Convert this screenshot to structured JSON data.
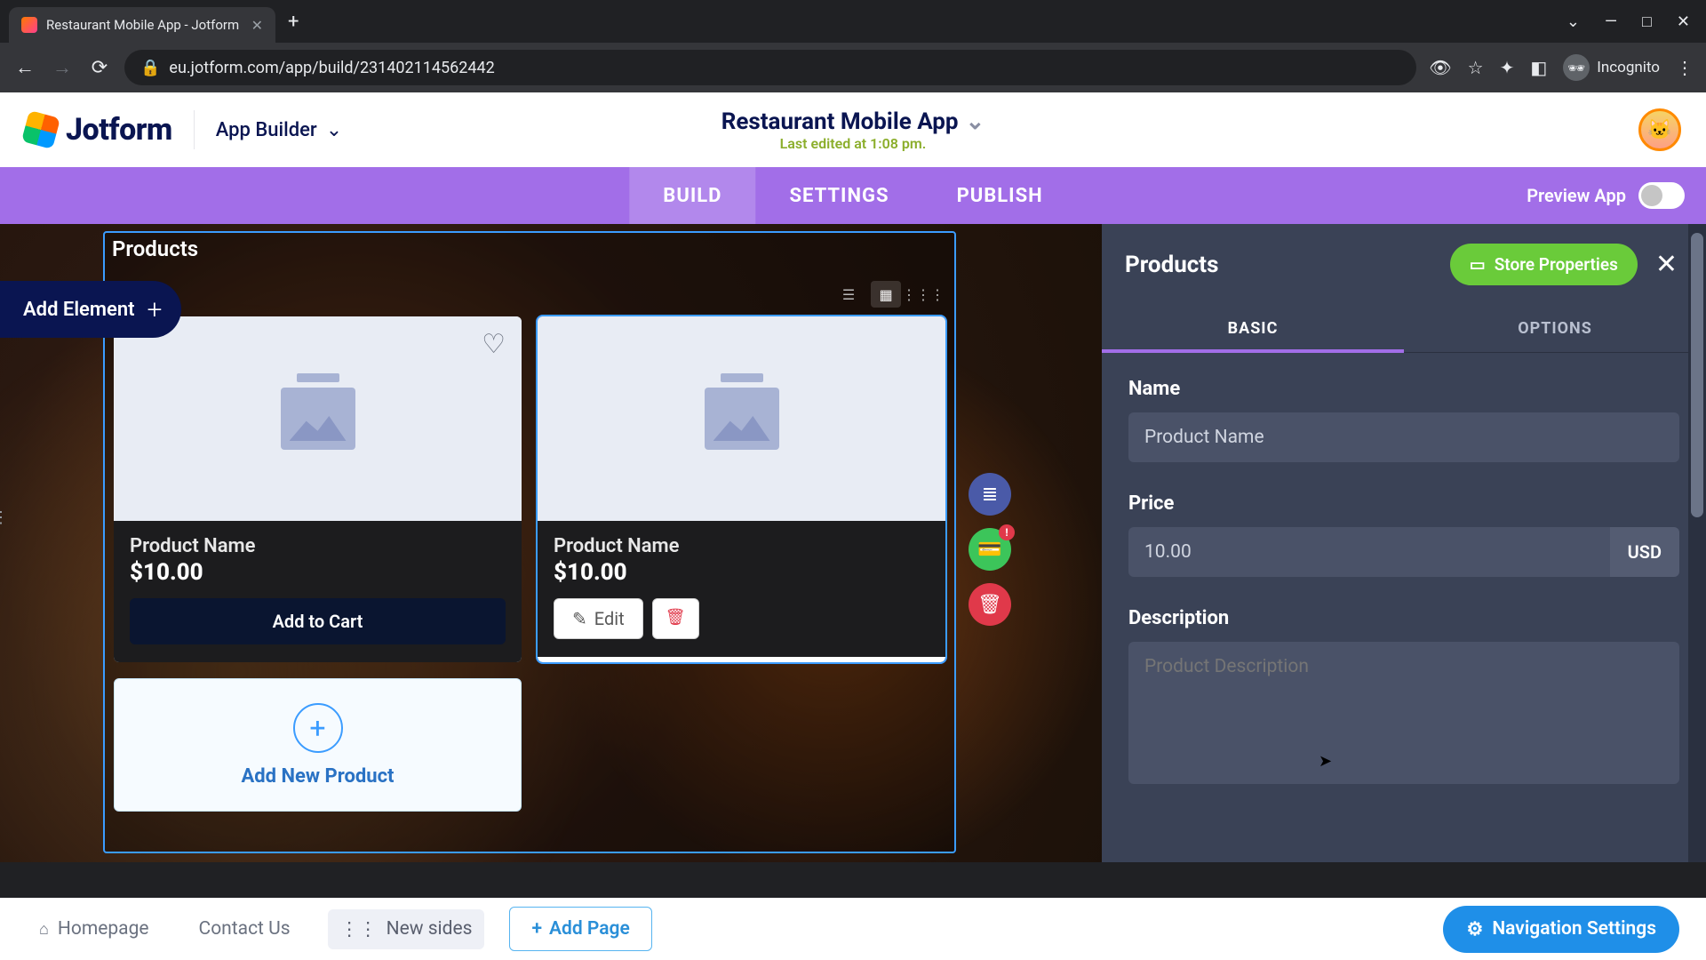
{
  "browser": {
    "tab_title": "Restaurant Mobile App - Jotform",
    "url": "eu.jotform.com/app/build/231402114562442",
    "incognito_label": "Incognito"
  },
  "header": {
    "logo_text": "Jotform",
    "section_label": "App Builder",
    "app_title": "Restaurant Mobile App",
    "last_edited": "Last edited at 1:08 pm."
  },
  "mode_tabs": {
    "build": "BUILD",
    "settings": "SETTINGS",
    "publish": "PUBLISH"
  },
  "preview_label": "Preview App",
  "add_element_label": "Add Element",
  "canvas": {
    "title": "Products",
    "products": [
      {
        "name": "Product Name",
        "price": "$10.00",
        "add_to_cart": "Add to Cart"
      },
      {
        "name": "Product Name",
        "price": "$10.00",
        "edit": "Edit"
      }
    ],
    "add_new_label": "Add New Product"
  },
  "side_actions": {
    "badge": "!"
  },
  "props": {
    "panel_title": "Products",
    "store_properties": "Store Properties",
    "tab_basic": "BASIC",
    "tab_options": "OPTIONS",
    "name_label": "Name",
    "name_value": "Product Name",
    "price_label": "Price",
    "price_value": "10.00",
    "currency": "USD",
    "description_label": "Description",
    "description_placeholder": "Product Description"
  },
  "pagebar": {
    "homepage": "Homepage",
    "contact": "Contact Us",
    "new_sides": "New sides",
    "add_page": "Add Page",
    "nav_settings": "Navigation Settings"
  }
}
